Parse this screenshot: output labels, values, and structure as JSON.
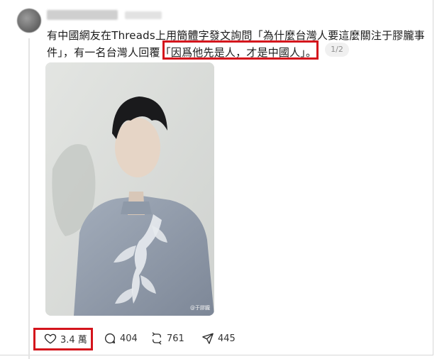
{
  "post": {
    "text_line1": "有中國網友在Threads上用簡體字發文詢問「為什麼台灣人要這麼關注于膠朧事",
    "text_line2_prefix": "件」，有一名台灣人回覆",
    "text_line2_quote": "「因爲他先是人，才是中國人」",
    "text_line2_suffix": "。",
    "page_indicator": "1/2",
    "image_watermark": "@于膠朧"
  },
  "actions": {
    "likes": "3.4 萬",
    "comments": "404",
    "reposts": "761",
    "shares": "445"
  },
  "colors": {
    "highlight": "#d4141c",
    "jacket": "#8e99a8",
    "background": "#d9dbd9"
  }
}
